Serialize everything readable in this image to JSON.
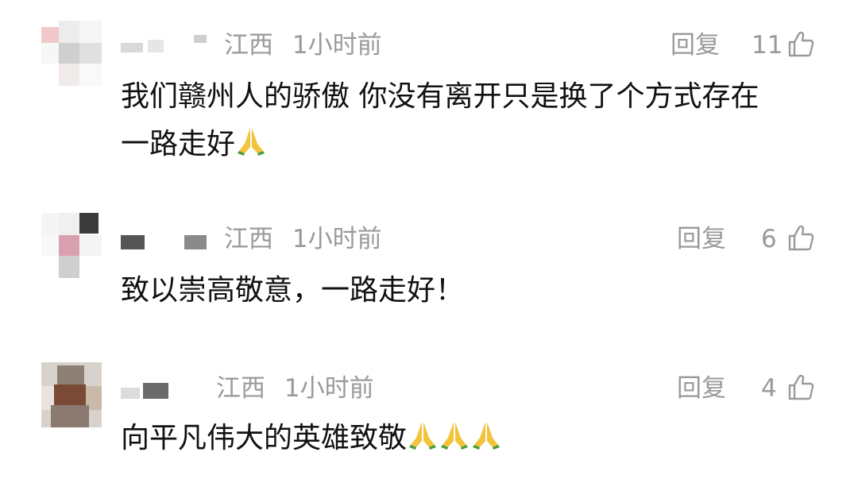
{
  "comments": [
    {
      "location": "江西",
      "time": "1小时前",
      "reply_label": "回复",
      "likes": "11",
      "text_line1": "我们赣州人的骄傲 你没有离开只是换了个方式存在",
      "text_line2": "一路走好",
      "emoji_count": 1
    },
    {
      "location": "江西",
      "time": "1小时前",
      "reply_label": "回复",
      "likes": "6",
      "text_line1": "致以崇高敬意，一路走好！",
      "emoji_count": 0
    },
    {
      "location": "江西",
      "time": "1小时前",
      "reply_label": "回复",
      "likes": "4",
      "text_line1": "向平凡伟大的英雄致敬",
      "emoji_count": 3
    }
  ],
  "icons": {
    "like": "thumbs-up-icon",
    "emoji": "folded-hands-emoji"
  },
  "colors": {
    "meta_text": "#9a9a9a",
    "body_text": "#111111"
  }
}
